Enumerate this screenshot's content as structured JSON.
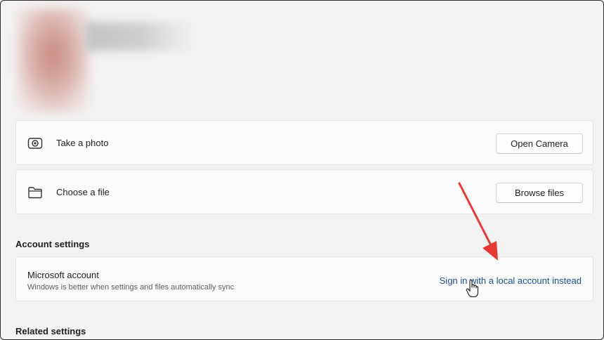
{
  "photo_row": {
    "label": "Take a photo",
    "icon": "camera-icon",
    "button_label": "Open Camera"
  },
  "file_row": {
    "label": "Choose a file",
    "icon": "folder-icon",
    "button_label": "Browse files"
  },
  "account_settings": {
    "heading": "Account settings",
    "microsoft_account": {
      "title": "Microsoft account",
      "subtitle": "Windows is better when settings and files automatically sync",
      "link_label": "Sign in with a local account instead"
    }
  },
  "related_settings": {
    "heading": "Related settings"
  },
  "annotation": {
    "arrow_color": "#e53935",
    "cursor_icon": "hand-pointer-icon"
  },
  "colors": {
    "background": "#f3f3f3",
    "card": "#fbfbfb",
    "link": "#1d4f91"
  }
}
